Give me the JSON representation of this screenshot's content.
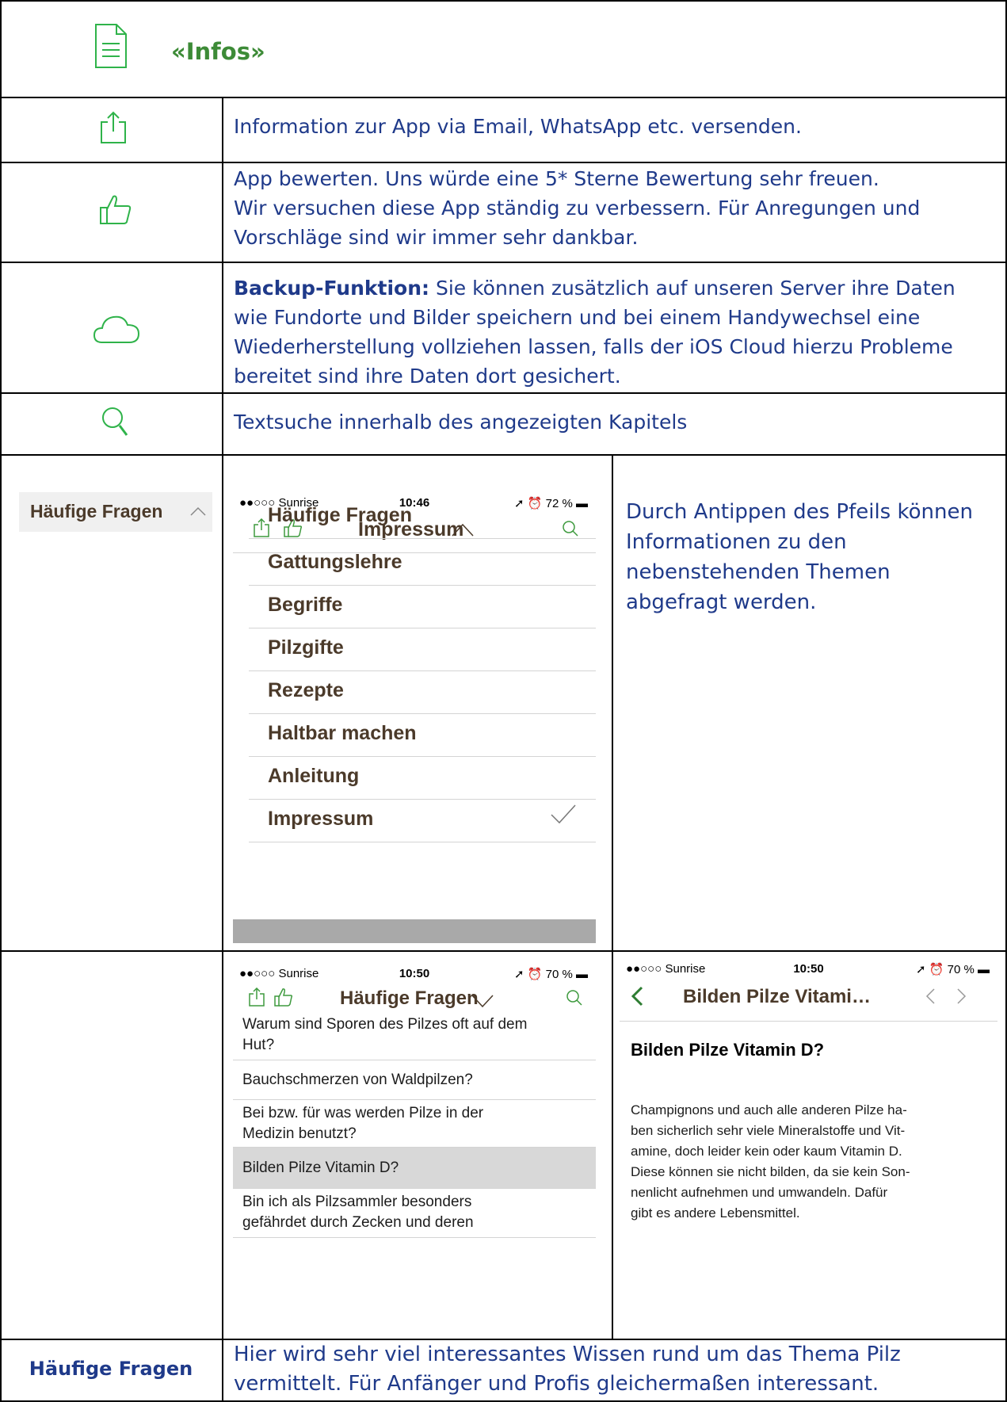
{
  "infos_title": "«Infos»",
  "rows": {
    "share": "Information zur App via Email, WhatsApp etc. versenden.",
    "rate_line1": "App bewerten. Uns würde eine 5* Sterne Bewertung sehr freuen.",
    "rate_line2": "Wir versuchen diese App ständig zu verbessern. Für Anregungen und",
    "rate_line3": "Vorschläge sind wir immer sehr dankbar.",
    "backup_label": "Backup-Funktion:",
    "backup_line1": " Sie können zusätzlich auf unseren Server ihre Daten",
    "backup_line2": "wie Fundorte und Bilder speichern und bei einem Handywechsel eine",
    "backup_line3": "Wiederherstellung vollziehen lassen, falls der iOS Cloud hierzu Probleme",
    "backup_line4": "bereitet sind ihre Daten dort gesichert.",
    "search": "Textsuche innerhalb des angezeigten Kapitels",
    "faq_button": "Häufige Fragen",
    "arrow_line1": "Durch Antippen des Pfeils können",
    "arrow_line2": "Informationen zu den",
    "arrow_line3": "nebenstehenden Themen",
    "arrow_line4": "abgefragt werden.",
    "bottom_label": "Häufige Fragen",
    "bottom_line1": "Hier wird sehr viel interessantes Wissen rund um das Thema Pilz",
    "bottom_line2": "vermittelt. Für Anfänger und Profis gleichermaßen interessant."
  },
  "phone1": {
    "carrier": "●●○○○ Sunrise",
    "time": "10:46",
    "battery": "72 %",
    "title": "Impressum",
    "menu": [
      "Häufige Fragen",
      "Gattungslehre",
      "Begriffe",
      "Pilzgifte",
      "Rezepte",
      "Haltbar machen",
      "Anleitung",
      "Impressum"
    ]
  },
  "phone2": {
    "carrier": "●●○○○ Sunrise",
    "time": "10:50",
    "battery": "70 %",
    "title": "Häufige Fragen",
    "items": [
      {
        "l1": "Warum sind Sporen des Pilzes oft auf dem",
        "l2": "Hut?"
      },
      {
        "l1": "Bauchschmerzen von Waldpilzen?",
        "l2": ""
      },
      {
        "l1": "Bei bzw. für was werden Pilze in der",
        "l2": "Medizin benutzt?"
      },
      {
        "l1": "Bilden Pilze Vitamin D?",
        "l2": ""
      },
      {
        "l1": "Bin ich als Pilzsammler besonders",
        "l2": "gefährdet durch Zecken und deren"
      }
    ]
  },
  "phone3": {
    "carrier": "●●○○○ Sunrise",
    "time": "10:50",
    "battery": "70 %",
    "title": "Bilden Pilze Vitami…",
    "heading": "Bilden Pilze Vitamin D?",
    "lines": [
      "Champignons und auch alle anderen Pilze ha-",
      "ben sicherlich sehr viele Mineralstoffe und Vit-",
      "amine, doch leider kein oder kaum Vitamin D.",
      "Diese können sie nicht bilden, da sie kein Son-",
      "nenlicht aufnehmen und umwandeln. Dafür",
      "gibt es andere Lebensmittel."
    ]
  }
}
